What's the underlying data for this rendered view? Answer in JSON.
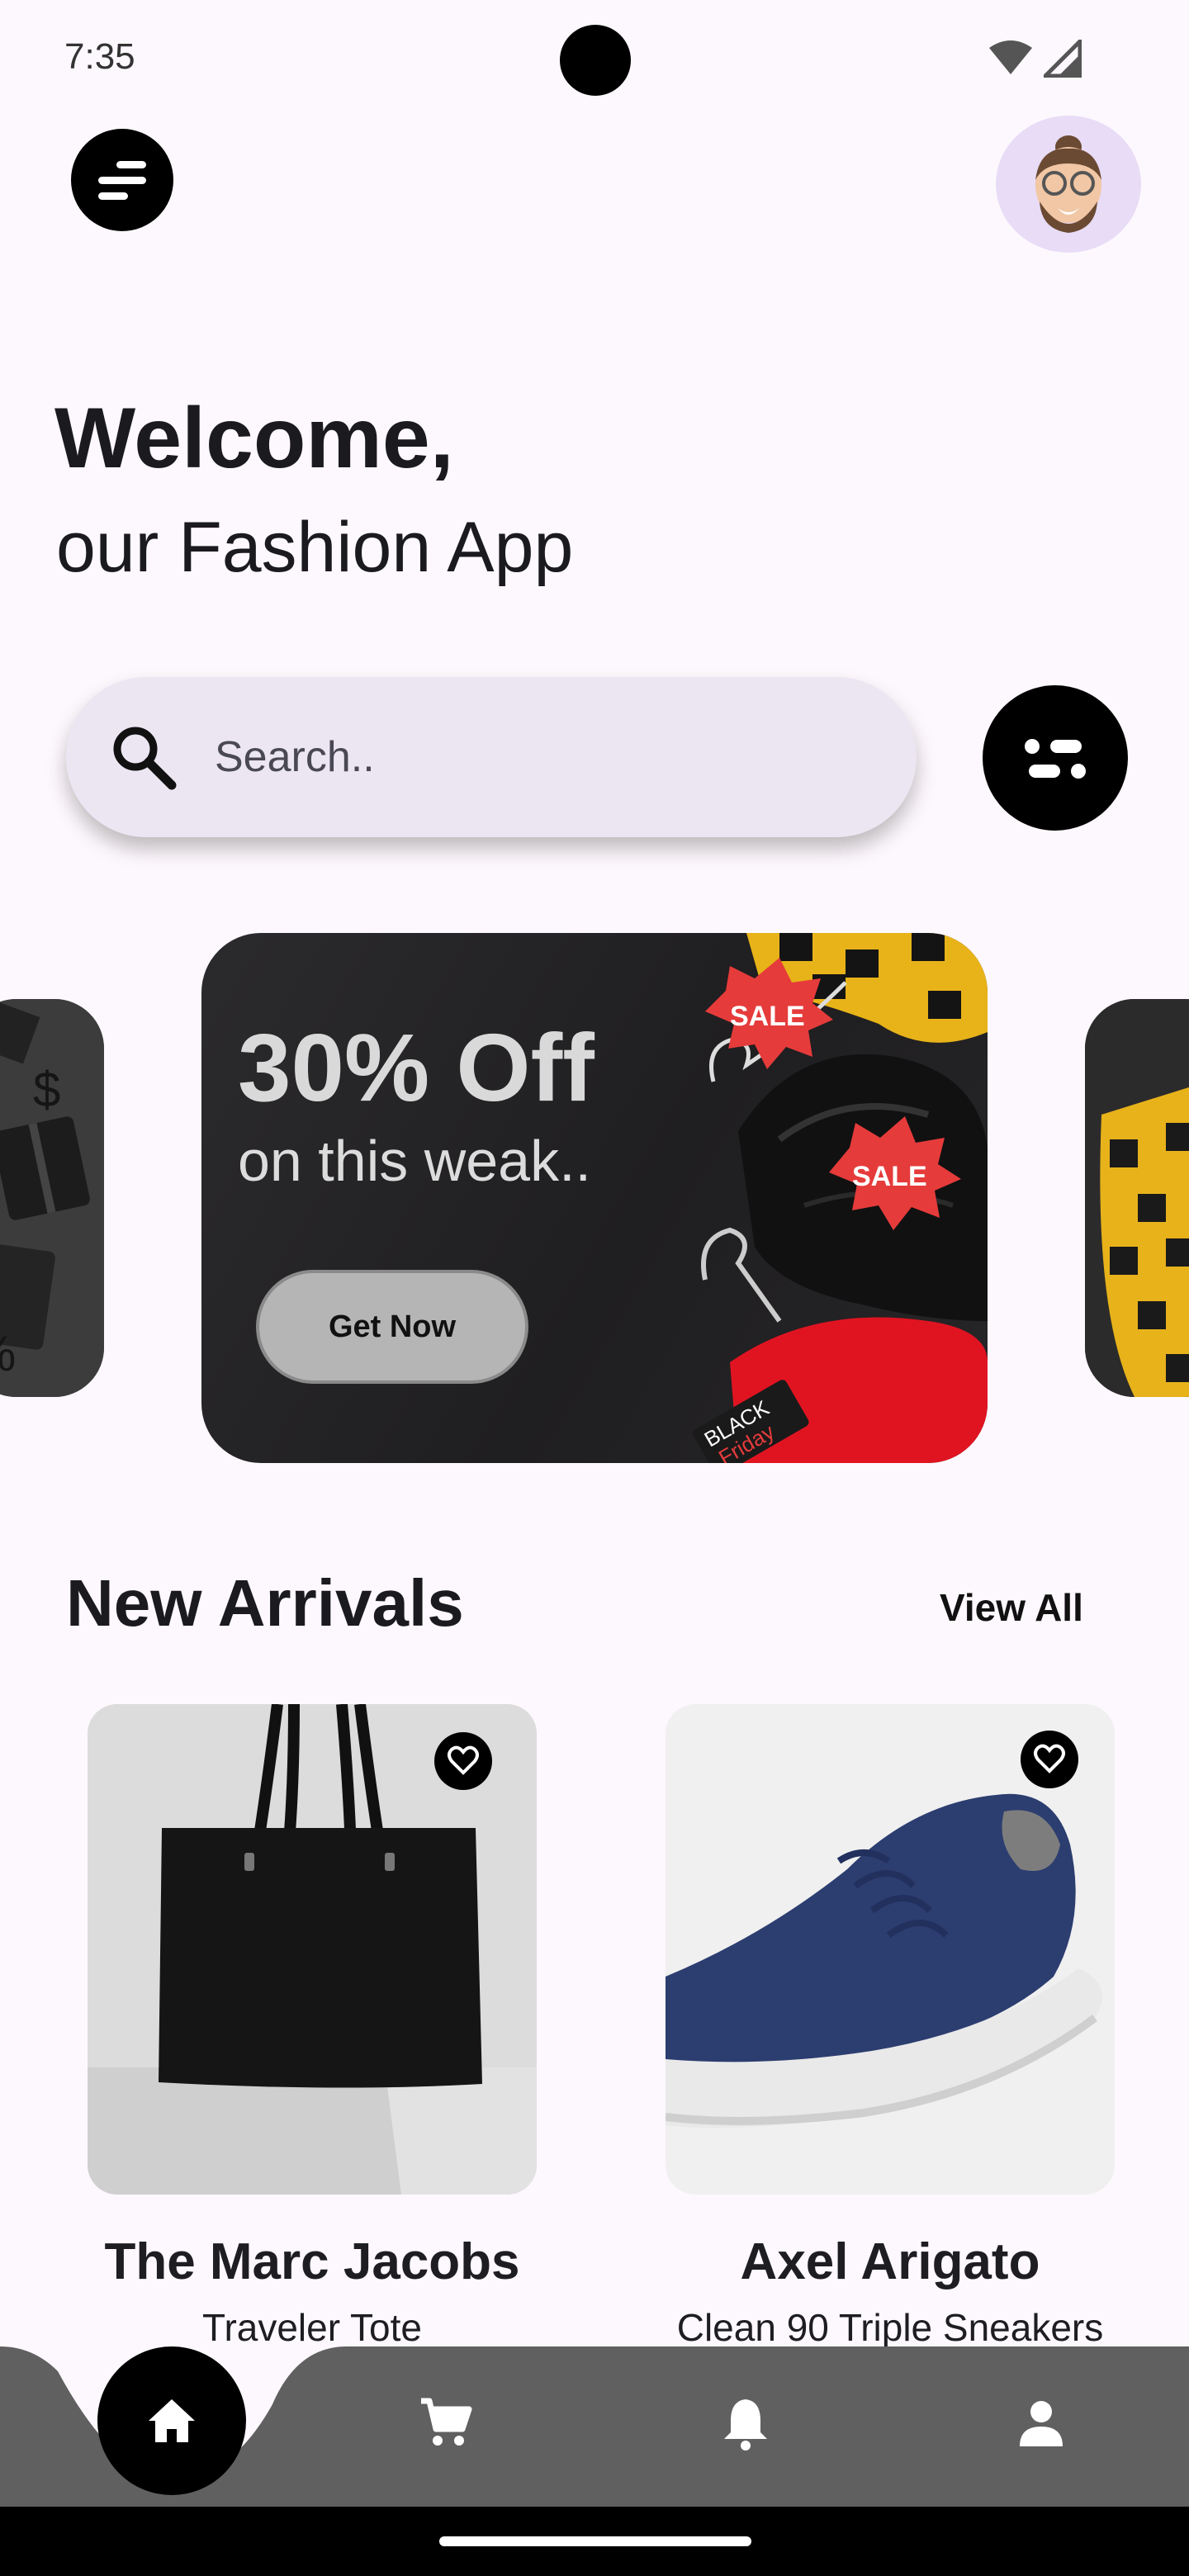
{
  "status_bar": {
    "time": "7:35"
  },
  "header": {
    "menu_icon": "menu-icon",
    "avatar_icon": "avatar-icon"
  },
  "greeting": {
    "title": "Welcome,",
    "subtitle": "our Fashion App"
  },
  "search": {
    "placeholder": "Search..",
    "icon": "search-icon",
    "filter_icon": "filter-icon"
  },
  "banner": {
    "title": "30% Off",
    "subtitle": "on this weak..",
    "button_label": "Get Now",
    "tags": [
      "SALE",
      "SALE",
      "BLACK",
      "Friday"
    ]
  },
  "side_card_left": {
    "glyphs": [
      "$",
      "%"
    ]
  },
  "new_arrivals": {
    "title": "New Arrivals",
    "view_all_label": "View All",
    "products": [
      {
        "name": "The Marc Jacobs",
        "description": "Traveler Tote",
        "fav_icon": "heart-icon"
      },
      {
        "name": "Axel Arigato",
        "description": "Clean 90 Triple Sneakers",
        "fav_icon": "heart-icon"
      }
    ]
  },
  "bottom_nav": {
    "items": [
      {
        "icon": "home-icon",
        "active": true
      },
      {
        "icon": "cart-icon",
        "active": false
      },
      {
        "icon": "bell-icon",
        "active": false
      },
      {
        "icon": "profile-icon",
        "active": false
      }
    ],
    "color": "#606060"
  },
  "colors": {
    "background": "#fdf8fd",
    "search_bg": "#ece6f3",
    "avatar_bg": "#e8dcf6",
    "sale_red": "#e63b3b"
  }
}
